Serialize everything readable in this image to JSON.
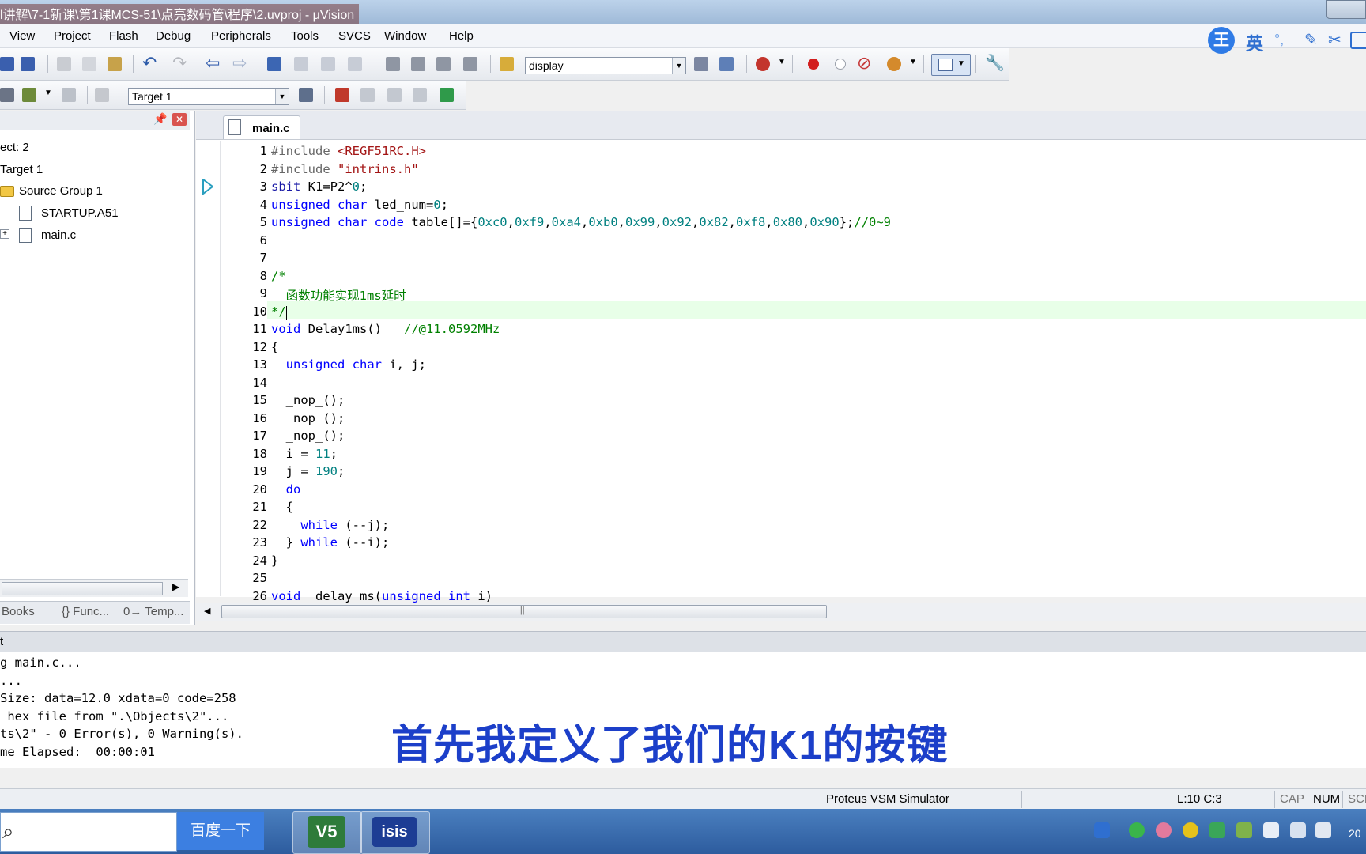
{
  "window": {
    "title": "l讲解\\7-1新课\\第1课MCS-51\\点亮数码管\\程序\\2.uvproj - μVision"
  },
  "menu": [
    "View",
    "Project",
    "Flash",
    "Debug",
    "Peripherals",
    "Tools",
    "SVCS",
    "Window",
    "Help"
  ],
  "toolbar": {
    "find_combo": "display",
    "target_combo": "Target 1"
  },
  "ime": {
    "label": "英",
    "logo": "王"
  },
  "project": {
    "root": "ect: 2",
    "target": "Target 1",
    "group": "Source Group 1",
    "files": [
      "STARTUP.A51",
      "main.c"
    ],
    "tabs": [
      "Books",
      "{} Func...",
      "0→ Temp..."
    ]
  },
  "editor": {
    "tab": "main.c",
    "cursor_line": 10,
    "lines": [
      {
        "n": "1",
        "segs": [
          [
            "pp",
            "#include "
          ],
          [
            "str",
            "<REGF51RC.H>"
          ]
        ]
      },
      {
        "n": "2",
        "segs": [
          [
            "pp",
            "#include "
          ],
          [
            "str",
            "\"intrins.h\""
          ]
        ]
      },
      {
        "n": "3",
        "segs": [
          [
            "kwd",
            "sbit "
          ],
          [
            "t",
            "K1=P2^"
          ],
          [
            "num",
            "0"
          ],
          [
            "t",
            ";"
          ]
        ]
      },
      {
        "n": "4",
        "segs": [
          [
            "kw",
            "unsigned char "
          ],
          [
            "t",
            "led_num="
          ],
          [
            "num",
            "0"
          ],
          [
            "t",
            ";"
          ]
        ]
      },
      {
        "n": "5",
        "segs": [
          [
            "kw",
            "unsigned char code "
          ],
          [
            "t",
            "table[]={"
          ],
          [
            "num",
            "0xc0"
          ],
          [
            "t",
            ","
          ],
          [
            "num",
            "0xf9"
          ],
          [
            "t",
            ","
          ],
          [
            "num",
            "0xa4"
          ],
          [
            "t",
            ","
          ],
          [
            "num",
            "0xb0"
          ],
          [
            "t",
            ","
          ],
          [
            "num",
            "0x99"
          ],
          [
            "t",
            ","
          ],
          [
            "num",
            "0x92"
          ],
          [
            "t",
            ","
          ],
          [
            "num",
            "0x82"
          ],
          [
            "t",
            ","
          ],
          [
            "num",
            "0xf8"
          ],
          [
            "t",
            ","
          ],
          [
            "num",
            "0x80"
          ],
          [
            "t",
            ","
          ],
          [
            "num",
            "0x90"
          ],
          [
            "t",
            "};"
          ],
          [
            "com",
            "//0~9"
          ]
        ]
      },
      {
        "n": "6",
        "segs": []
      },
      {
        "n": "7",
        "segs": []
      },
      {
        "n": "8",
        "segs": [
          [
            "com",
            "/*"
          ]
        ]
      },
      {
        "n": "9",
        "segs": [
          [
            "com",
            "  函数功能实现1ms延时"
          ]
        ]
      },
      {
        "n": "10",
        "segs": [
          [
            "com",
            "*/"
          ]
        ]
      },
      {
        "n": "11",
        "segs": [
          [
            "kw",
            "void "
          ],
          [
            "t",
            "Delay1ms()   "
          ],
          [
            "com",
            "//@11.0592MHz"
          ]
        ]
      },
      {
        "n": "12",
        "segs": [
          [
            "t",
            "{"
          ]
        ]
      },
      {
        "n": "13",
        "segs": [
          [
            "kw",
            "  unsigned char "
          ],
          [
            "t",
            "i, j;"
          ]
        ]
      },
      {
        "n": "14",
        "segs": []
      },
      {
        "n": "15",
        "segs": [
          [
            "t",
            "  _nop_();"
          ]
        ]
      },
      {
        "n": "16",
        "segs": [
          [
            "t",
            "  _nop_();"
          ]
        ]
      },
      {
        "n": "17",
        "segs": [
          [
            "t",
            "  _nop_();"
          ]
        ]
      },
      {
        "n": "18",
        "segs": [
          [
            "t",
            "  i = "
          ],
          [
            "num",
            "11"
          ],
          [
            "t",
            ";"
          ]
        ]
      },
      {
        "n": "19",
        "segs": [
          [
            "t",
            "  j = "
          ],
          [
            "num",
            "190"
          ],
          [
            "t",
            ";"
          ]
        ]
      },
      {
        "n": "20",
        "segs": [
          [
            "kw",
            "  do"
          ]
        ]
      },
      {
        "n": "21",
        "segs": [
          [
            "t",
            "  {"
          ]
        ]
      },
      {
        "n": "22",
        "segs": [
          [
            "kw",
            "    while "
          ],
          [
            "t",
            "(--j);"
          ]
        ]
      },
      {
        "n": "23",
        "segs": [
          [
            "t",
            "  } "
          ],
          [
            "kw",
            "while "
          ],
          [
            "t",
            "(--i);"
          ]
        ]
      },
      {
        "n": "24",
        "segs": [
          [
            "t",
            "}"
          ]
        ]
      },
      {
        "n": "25",
        "segs": []
      },
      {
        "n": "26",
        "segs": [
          [
            "kw",
            "void "
          ],
          [
            "t",
            " delay_ms("
          ],
          [
            "kw",
            "unsigned int "
          ],
          [
            "t",
            "i)"
          ]
        ]
      }
    ]
  },
  "build": {
    "header": "t",
    "lines": [
      "g main.c...",
      "...",
      "Size: data=12.0 xdata=0 code=258",
      " hex file from \".\\Objects\\2\"...",
      "ts\\2\" - 0 Error(s), 0 Warning(s).",
      "me Elapsed:  00:00:01"
    ]
  },
  "subtitle": "首先我定义了我们的K1的按键",
  "status": {
    "debugger": "Proteus VSM Simulator",
    "position": "L:10 C:3",
    "cap": "CAP",
    "num": "NUM",
    "scrl": "SCR"
  },
  "taskbar": {
    "search_button": "百度一下",
    "apps": [
      "V5",
      "isis"
    ],
    "clock_fragment": "20"
  },
  "colors": {
    "keyword": "#0000ff",
    "number": "#008080",
    "string": "#a31515",
    "comment": "#008000",
    "subtitle": "#1c3fc9"
  }
}
